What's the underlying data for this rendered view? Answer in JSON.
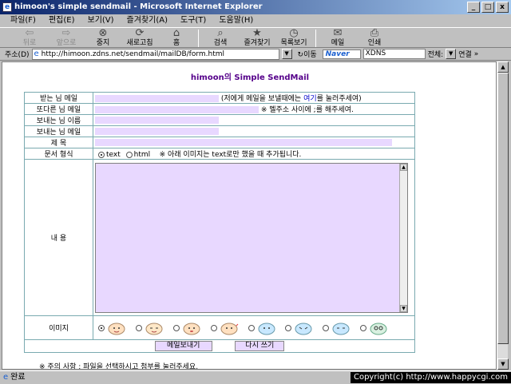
{
  "window": {
    "title": "himoon's simple sendmail - Microsoft Internet Explorer",
    "controls": [
      "_",
      "□",
      "x"
    ]
  },
  "menu": [
    "파일(F)",
    "편집(E)",
    "보기(V)",
    "즐겨찾기(A)",
    "도구(T)",
    "도움말(H)"
  ],
  "toolbar": [
    {
      "icon": "back-arrow-icon",
      "label": "뒤로",
      "enabled": false
    },
    {
      "icon": "forward-arrow-icon",
      "label": "앞으로",
      "enabled": false
    },
    {
      "icon": "stop-icon",
      "label": "중지",
      "enabled": true
    },
    {
      "icon": "refresh-icon",
      "label": "새로고침",
      "enabled": true
    },
    {
      "icon": "home-icon",
      "label": "홈",
      "enabled": true
    },
    {
      "icon": "search-icon",
      "label": "검색",
      "enabled": true
    },
    {
      "icon": "favorites-icon",
      "label": "즐겨찾기",
      "enabled": true
    },
    {
      "icon": "history-icon",
      "label": "목록보기",
      "enabled": true
    },
    {
      "icon": "mail-icon",
      "label": "메일",
      "enabled": true
    },
    {
      "icon": "print-icon",
      "label": "인쇄",
      "enabled": true
    }
  ],
  "address": {
    "label": "주소(D)",
    "url": "http://himoon.zdns.net/sendmail/mailDB/form.html",
    "go": "이동",
    "search_brand": "Naver",
    "search_text": "XDNS",
    "all": "전체:",
    "links": "연결"
  },
  "page": {
    "title": "himoon의 Simple SendMail",
    "fields": {
      "to_label": "받는 님 메일",
      "to_note": "(저에게 메일을 보낼때에는 여기를 눌러주세여)",
      "to_note_link": "여기",
      "other_label": "또다른 님 메일",
      "other_note": "※ 멜주소 사이에 ;를 해주세여.",
      "sender_name_label": "보내는 님 이름",
      "sender_mail_label": "보내는 님 메일",
      "subject_label": "제    목",
      "format_label": "문서 형식",
      "format_options": [
        "text",
        "html"
      ],
      "format_selected": "text",
      "format_note": "※ 아래 이미지는 text로만 했을 때 추가됩니다.",
      "body_label": "내    용",
      "image_label": "이미지"
    },
    "buttons": {
      "send": "메일보내기",
      "reset": "다시 쓰기"
    },
    "footnote": "※ 주의 사항 : 파일을 선택하시고 첨부를 눌러주세요."
  },
  "status": {
    "text": "완료"
  },
  "copyright": "Copyright(c) http://www.happycgi.com",
  "colors": {
    "input_fill": "#e8d8ff",
    "title_color": "#55008a",
    "border": "#7aaab0"
  }
}
